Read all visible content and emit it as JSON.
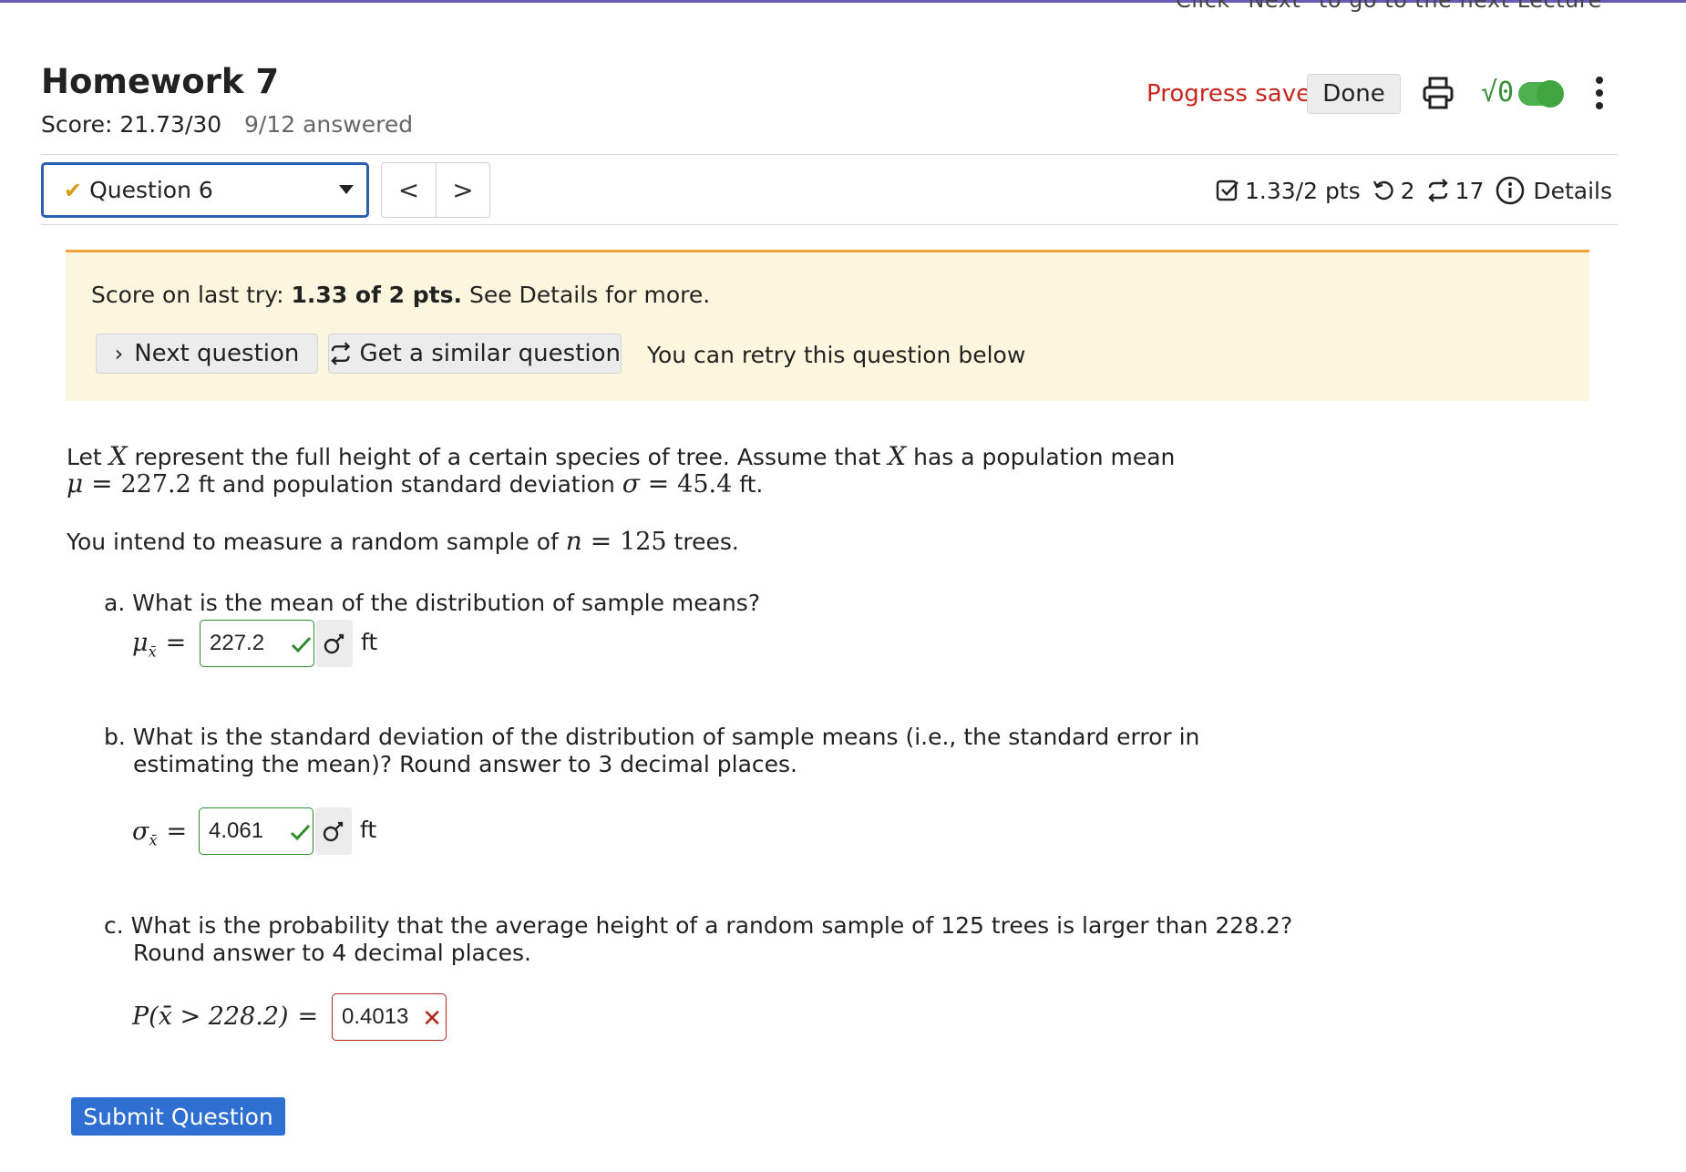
{
  "top_banner_fragment": "Click \"Next\" to go to the next Lecture",
  "header": {
    "title": "Homework 7",
    "score": "Score: 21.73/30",
    "answered": "9/12 answered",
    "progress_saved": "Progress saved",
    "done_label": "Done",
    "sqrt_label": "√0"
  },
  "question_nav": {
    "selected": "Question 6",
    "prev": "<",
    "next": ">"
  },
  "meta": {
    "points": "1.33/2 pts",
    "retries": "2",
    "similar_count": "17",
    "details": "Details"
  },
  "notice": {
    "prefix": "Score on last try: ",
    "score_bold": "1.33 of 2 pts.",
    "suffix": " See Details for more.",
    "next_question": "Next question",
    "similar_question": "Get a similar question",
    "retry": "You can retry this question below"
  },
  "problem": {
    "intro_1": "Let ",
    "X1": "X",
    "intro_2": " represent the full height of a certain species of tree. Assume that ",
    "X2": "X",
    "intro_3": " has a population mean",
    "mu_eq": "μ = ",
    "mu_val": "227.2",
    "line2_a": " ft and population standard deviation ",
    "sigma_eq": "σ = ",
    "sigma_val": "45.4",
    "line2_b": " ft.",
    "sample_a": "You intend to measure a random sample of ",
    "n_eq": "n = ",
    "n_val": "125",
    "sample_b": " trees."
  },
  "parts": {
    "a_question": "a. What is the mean of the distribution of sample means?",
    "a_lhs": "μ",
    "a_sub": "x̄",
    "a_answer": "227.2",
    "a_unit": "ft",
    "b_question_1": "b. What is the standard deviation of the distribution of sample means (i.e., the standard error in",
    "b_question_2": "estimating the mean)? Round answer to 3 decimal places.",
    "b_lhs": "σ",
    "b_sub": "x̄",
    "b_answer": "4.061",
    "b_unit": "ft",
    "c_question_1": "c. What is the probability that the average height of a random sample of 125 trees is larger than 228.2?",
    "c_question_2": "Round answer to 4 decimal places.",
    "c_lhs": "P(x̄ > 228.2)",
    "c_answer": "0.4013"
  },
  "submit_label": "Submit Question",
  "colors": {
    "accent_blue": "#2f6fd1",
    "correct_green": "#2e8b2e",
    "wrong_red": "#b3261e",
    "saved_red": "#c8261c",
    "notice_bg": "#fdf6df",
    "notice_border": "#f0a23b"
  },
  "icons": [
    "check-icon",
    "chevron-down-icon",
    "chevron-left-icon",
    "chevron-right-icon",
    "print-icon",
    "sqrt-icon",
    "kebab-menu-icon",
    "checkbox-icon",
    "retry-icon",
    "similar-icon",
    "info-icon",
    "key-icon",
    "x-icon"
  ]
}
